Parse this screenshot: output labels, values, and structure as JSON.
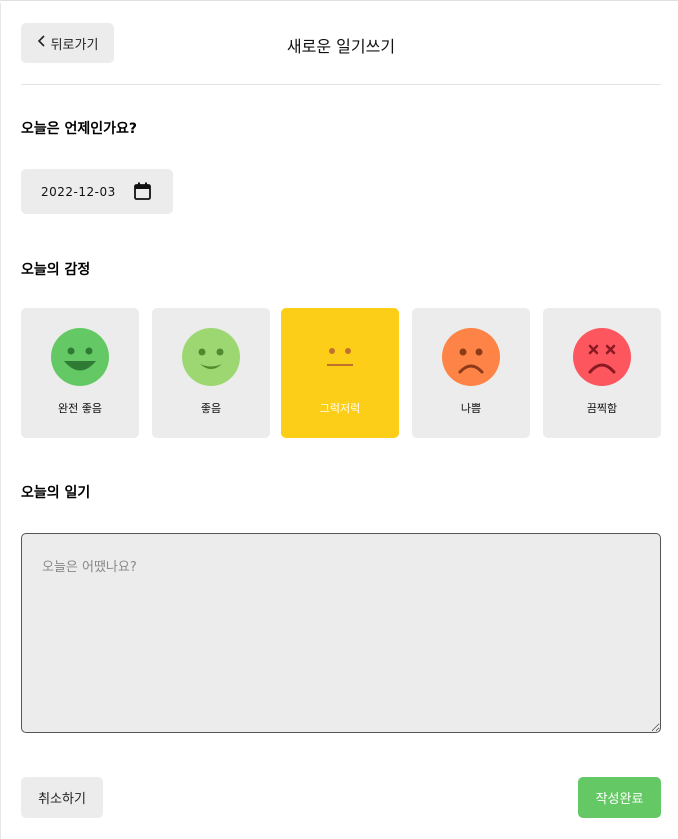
{
  "header": {
    "back_label": "뒤로가기",
    "title": "새로운 일기쓰기"
  },
  "date_section": {
    "title": "오늘은 언제인가요?",
    "date_value": "2022-12-03"
  },
  "emotion_section": {
    "title": "오늘의 감정",
    "items": [
      {
        "label": "완전 좋음",
        "color": "#64c964"
      },
      {
        "label": "좋음",
        "color": "#9dd772"
      },
      {
        "label": "그럭저럭",
        "color": "#fdce17"
      },
      {
        "label": "나쁨",
        "color": "#fd8446"
      },
      {
        "label": "끔찍함",
        "color": "#fd565f"
      }
    ],
    "selected_index": 2
  },
  "diary_section": {
    "title": "오늘의 일기",
    "placeholder": "오늘은 어땠나요?"
  },
  "footer": {
    "cancel_label": "취소하기",
    "submit_label": "작성완료"
  },
  "colors": {
    "accent_submit": "#64c964",
    "selected_bg": "#fdce17",
    "tile_bg": "#ececec"
  }
}
